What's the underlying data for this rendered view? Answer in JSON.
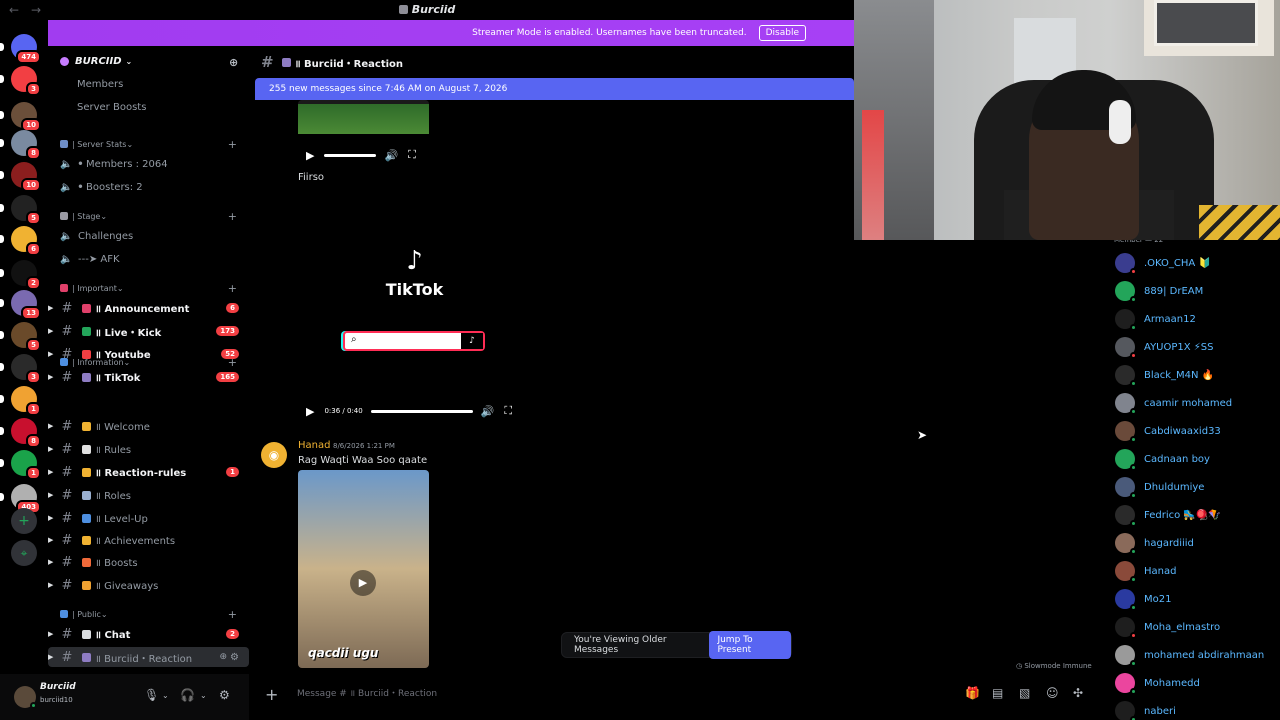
{
  "window": {
    "title": "Burciid",
    "back": "←",
    "forward": "→"
  },
  "banner": {
    "text": "Streamer Mode is enabled. Usernames have been truncated.",
    "button": "Disable"
  },
  "rail": {
    "servers": [
      {
        "badge": "474",
        "color": "#5865f2"
      },
      {
        "badge": "3",
        "color": "#f23f43"
      },
      {
        "badge": "10",
        "color": "#6b4f3a"
      },
      {
        "badge": "8",
        "color": "#7a8aa0"
      },
      {
        "badge": "10",
        "color": "#8b1e1e"
      },
      {
        "badge": "5",
        "color": "#222222"
      },
      {
        "badge": "6",
        "color": "#f0b232"
      },
      {
        "badge": "2",
        "color": "#111111"
      },
      {
        "badge": "13",
        "color": "#7a6ab0"
      },
      {
        "badge": "5",
        "color": "#6a4a2a"
      },
      {
        "badge": "3",
        "color": "#2a2a2a"
      },
      {
        "badge": "1",
        "color": "#f0a232"
      },
      {
        "badge": "8",
        "color": "#c8102e"
      },
      {
        "badge": "1",
        "color": "#1aa34a"
      },
      {
        "badge": "403",
        "color": "#b0b0b0"
      }
    ],
    "add": "+",
    "discover": "⌖"
  },
  "server": {
    "name": "BURCIID"
  },
  "sidebar": {
    "top": [
      {
        "label": "Members"
      },
      {
        "label": "Server Boosts"
      }
    ],
    "categories": [
      {
        "label": "| Server Stats",
        "channels": [
          {
            "label": "ꔷ Members : 2064"
          },
          {
            "label": "ꔷ Boosters: 2"
          }
        ]
      },
      {
        "label": "| Stage",
        "channels": [
          {
            "label": "Challenges"
          },
          {
            "label": "---➤ AFK"
          }
        ]
      },
      {
        "label": "| Important",
        "channels": [
          {
            "label": "॥ Announcement",
            "count": "6"
          },
          {
            "label": "॥ Live・Kick",
            "count": "173"
          },
          {
            "label": "॥ Youtube",
            "count": "52"
          },
          {
            "label": "॥ TikTok",
            "count": "165"
          }
        ]
      },
      {
        "label": "| Information",
        "channels": [
          {
            "label": "॥ Welcome"
          },
          {
            "label": "॥ Rules"
          },
          {
            "label": "॥ Reaction-rules",
            "count": "1"
          },
          {
            "label": "॥ Roles"
          },
          {
            "label": "॥ Level-Up"
          },
          {
            "label": "॥ Achievements"
          },
          {
            "label": "॥ Boosts"
          },
          {
            "label": "॥ Giveaways"
          }
        ]
      },
      {
        "label": "| Public",
        "channels": [
          {
            "label": "॥ Chat",
            "count": "2"
          },
          {
            "label": "॥ Burciid・Reaction"
          }
        ]
      }
    ]
  },
  "user": {
    "name": "Burciid",
    "tag": "burciid10"
  },
  "chat": {
    "channel": "॥ Burciid・Reaction",
    "new_messages": "255 new messages since 7:46 AM on August 7, 2026",
    "messages": [
      {
        "text": "Fiirso",
        "video_time": "0:36 / 0:40",
        "tiktok_label": "TikTok"
      },
      {
        "author": "Hanad",
        "time": "8/6/2026 1:21 PM",
        "text": "Rag Waqti Waa Soo qaate",
        "caption": "qacdii ugu"
      }
    ],
    "older_text": "You're Viewing Older Messages",
    "jump_button": "Jump To Present",
    "slowmode": "Slowmode Immune",
    "composer_placeholder": "Message # ॥ Burciid・Reaction"
  },
  "members": {
    "header": "Member — 22",
    "list": [
      {
        "name": ".OKO_CHA 🔰",
        "color": "#3a3d8f",
        "status": "#f23f43"
      },
      {
        "name": "889| DrEAM",
        "color": "#23a55a",
        "status": "#23a55a"
      },
      {
        "name": "Armaan12",
        "color": "#1e1e1e",
        "status": "#23a55a"
      },
      {
        "name": "AYUOP1X ⚡SS",
        "color": "#55585e",
        "status": "#f23f43"
      },
      {
        "name": "Black_M4N 🔥",
        "color": "#2a2a2a",
        "status": "#23a55a"
      },
      {
        "name": "caamir mohamed",
        "color": "#80848e",
        "status": "#23a55a"
      },
      {
        "name": "Cabdiwaaxid33",
        "color": "#6a4a3a",
        "status": "#23a55a"
      },
      {
        "name": "Cadnaan boy",
        "color": "#23a55a",
        "status": "#23a55a"
      },
      {
        "name": "Dhuldumiye",
        "color": "#4a5a7a",
        "status": "#23a55a"
      },
      {
        "name": "Fedrico 🛼🪀🪁",
        "color": "#2a2a2a",
        "status": "#23a55a"
      },
      {
        "name": "hagardiiid",
        "color": "#8a6a5a",
        "status": "#23a55a"
      },
      {
        "name": "Hanad",
        "color": "#8a4a3a",
        "status": "#23a55a"
      },
      {
        "name": "Mo21",
        "color": "#2a3aa0",
        "status": "#23a55a"
      },
      {
        "name": "Moha_elmastro",
        "color": "#1e1e1e",
        "status": "#f23f43"
      },
      {
        "name": "mohamed abdirahmaan",
        "color": "#9a9a9a",
        "status": "#23a55a"
      },
      {
        "name": "Mohamedd",
        "color": "#eb459e",
        "status": "#23a55a"
      },
      {
        "name": "naberi",
        "color": "#1e1e1e",
        "status": "#23a55a"
      }
    ]
  }
}
